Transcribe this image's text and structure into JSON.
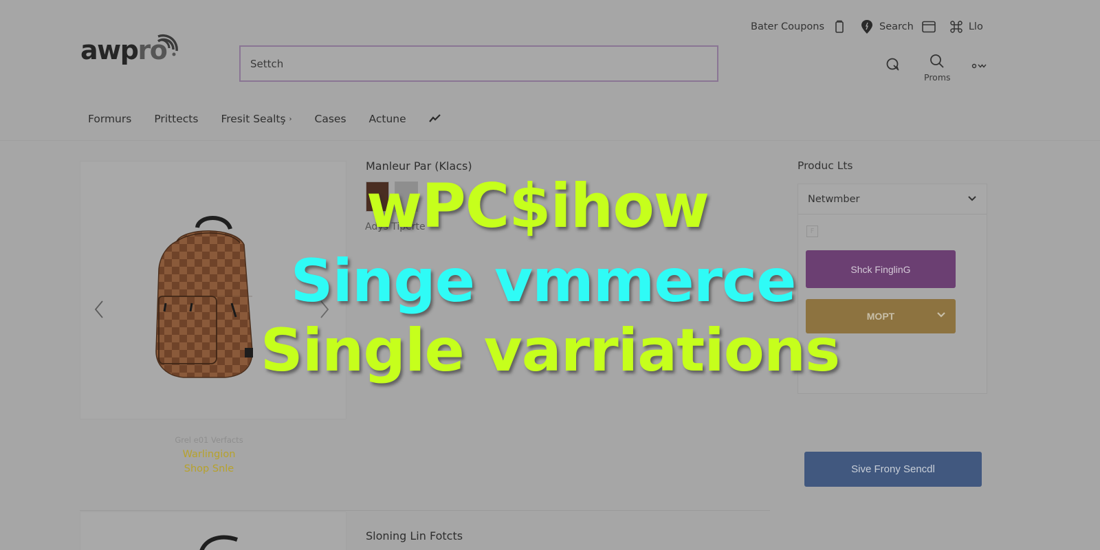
{
  "brand": {
    "logo_main": "awp",
    "logo_accent": "ro",
    "logo_dot": "."
  },
  "search": {
    "placeholder": "Settch",
    "value": ""
  },
  "utility_bar": {
    "items": [
      {
        "label": "Bater Coupons",
        "icon": "coupon-icon"
      },
      {
        "label": "",
        "icon": "shopping-bag-icon"
      },
      {
        "label": "Search",
        "icon": "location-pin-icon"
      },
      {
        "label": "",
        "icon": "window-icon"
      },
      {
        "label": "Llo",
        "icon": "command-icon"
      }
    ]
  },
  "header_icons": [
    {
      "label": "",
      "icon": "account-search-icon"
    },
    {
      "label": "Proms",
      "icon": "search-icon"
    },
    {
      "label": "",
      "icon": "more-dropdown-icon"
    }
  ],
  "nav": {
    "items": [
      {
        "label": "Formurs"
      },
      {
        "label": "Prittects"
      },
      {
        "label": "Fresit Sealtş",
        "has_caret": true
      },
      {
        "label": "Cases"
      },
      {
        "label": "Actune"
      }
    ],
    "trend_icon": "trend-icon"
  },
  "gallery": {
    "prev_icon": "chevron-left-icon",
    "next_icon": "chevron-right-icon",
    "caption_sub": "Grel e01 Verfacts",
    "caption_line1": "Warlingion",
    "caption_line2": "Shop Snle"
  },
  "product": {
    "title": "Manleur Par (Klacs)",
    "subtitle": "Adys Tiperte",
    "swatches": [
      "#4a2e22",
      "#8e8e8e"
    ]
  },
  "panel": {
    "title": "Produc Lts",
    "select_value": "Netwmber",
    "check_glyph": "F",
    "primary_button": "Shck FinglinG",
    "secondary_button": "MOPT"
  },
  "cta_button": "Sive Frony Sencdl",
  "second_product": {
    "title": "Sloning Lin Fotcts"
  },
  "overlay": {
    "line1": "wPC$ihow",
    "line2": "Singe vmmerce",
    "line3": "Single varriations"
  },
  "colors": {
    "overlay_green": "#c6ff1c",
    "overlay_cyan": "#2ffbf6",
    "button_purple": "#6b3f72",
    "button_gold": "#8d7340",
    "button_blue": "#41587f",
    "caption_gold": "#b7a22b"
  }
}
